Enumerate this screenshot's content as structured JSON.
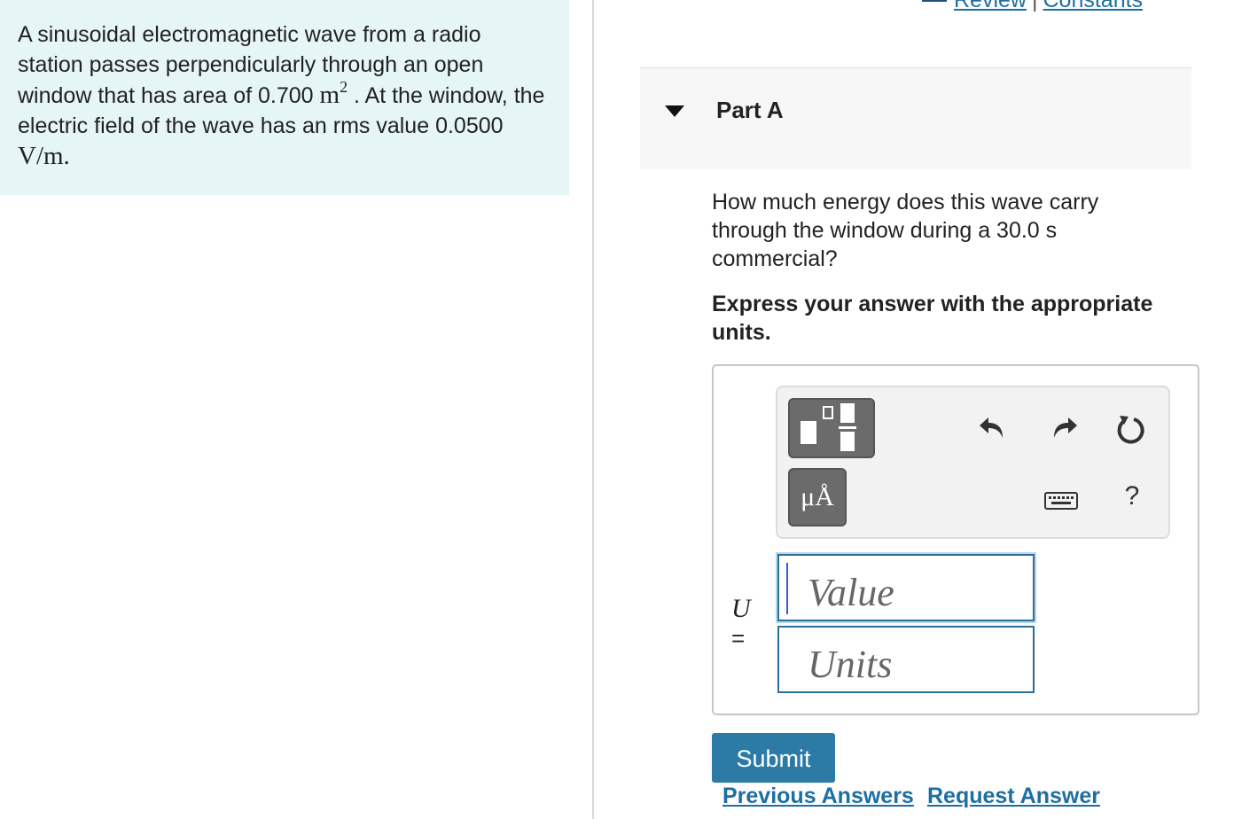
{
  "problem": {
    "text_part1": "A sinusoidal electromagnetic wave from a radio station passes perpendicularly through an open window that has area of 0.700 ",
    "area_unit": "m",
    "area_exp": "2",
    "text_part2": " . At the window, the electric field of the wave has an rms value ",
    "field_value": "0.0500 ",
    "field_unit": "V/m."
  },
  "top_links": {
    "review": "Review",
    "separator": "|",
    "constants": "Constants"
  },
  "part": {
    "title": "Part A",
    "question": "How much energy does this wave carry through the window during a 30.0 s commercial?",
    "instruction": "Express your answer with the appropriate units."
  },
  "toolbar": {
    "units_symbol": "μÅ",
    "help_label": "?"
  },
  "answer": {
    "variable": "U",
    "equals": "=",
    "value_placeholder": "Value",
    "units_placeholder": "Units"
  },
  "actions": {
    "submit_label": "Submit",
    "previous_answers": "Previous Answers",
    "request_answer": "Request Answer"
  },
  "colors": {
    "problem_bg": "#e6f5f5",
    "accent": "#2b7ba6",
    "link": "#1d6fa3"
  }
}
